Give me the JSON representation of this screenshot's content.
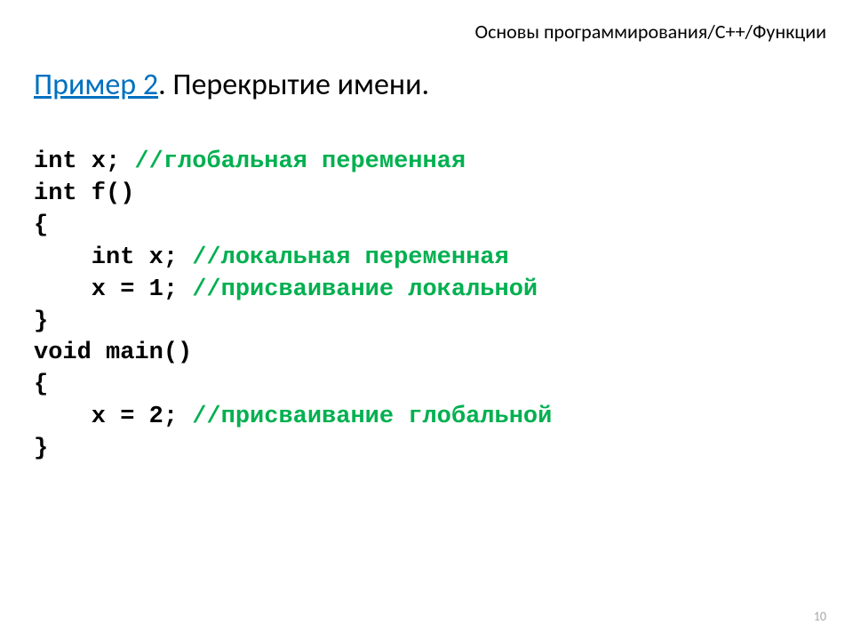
{
  "breadcrumb": "Основы программирования/C++/Функции",
  "heading": {
    "link": "Пример 2",
    "rest": ". Перекрытие имени."
  },
  "code": {
    "l1_code": "int x; ",
    "l1_comment": "//глобальная переменная",
    "l2_code": "int f()",
    "l3_code": "{",
    "l4_code": "    int x; ",
    "l4_comment": "//локальная переменная",
    "l5_code": "    x = 1; ",
    "l5_comment": "//присваивание локальной",
    "l6_code": "}",
    "l7_code": "void main()",
    "l8_code": "{",
    "l9_code": "    x = 2; ",
    "l9_comment": "//присваивание глобальной",
    "l10_code": "}"
  },
  "page_number": "10"
}
